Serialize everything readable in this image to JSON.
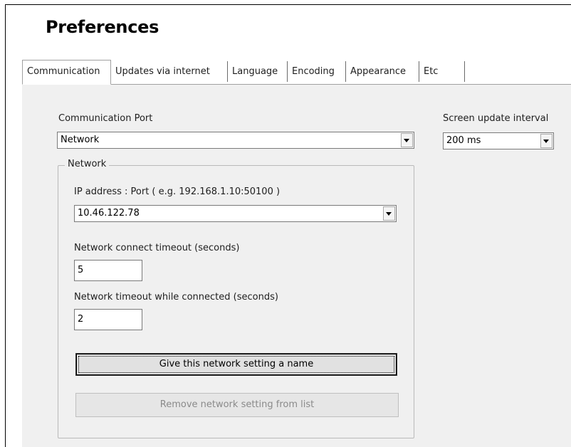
{
  "title": "Preferences",
  "tabs": [
    {
      "label": "Communication"
    },
    {
      "label": "Updates via internet"
    },
    {
      "label": "Language"
    },
    {
      "label": "Encoding"
    },
    {
      "label": "Appearance"
    },
    {
      "label": "Etc"
    }
  ],
  "communication": {
    "port_label": "Communication Port",
    "port_value": "Network",
    "interval_label": "Screen update interval",
    "interval_value": "200 ms",
    "network_group": {
      "title": "Network",
      "ip_label": "IP address : Port ( e.g. 192.168.1.10:50100 )",
      "ip_value": "10.46.122.78",
      "connect_timeout_label": "Network connect timeout (seconds)",
      "connect_timeout_value": "5",
      "timeout_connected_label": "Network timeout while connected (seconds)",
      "timeout_connected_value": "2",
      "name_button": "Give this network setting a name",
      "remove_button": "Remove network setting from list"
    }
  }
}
